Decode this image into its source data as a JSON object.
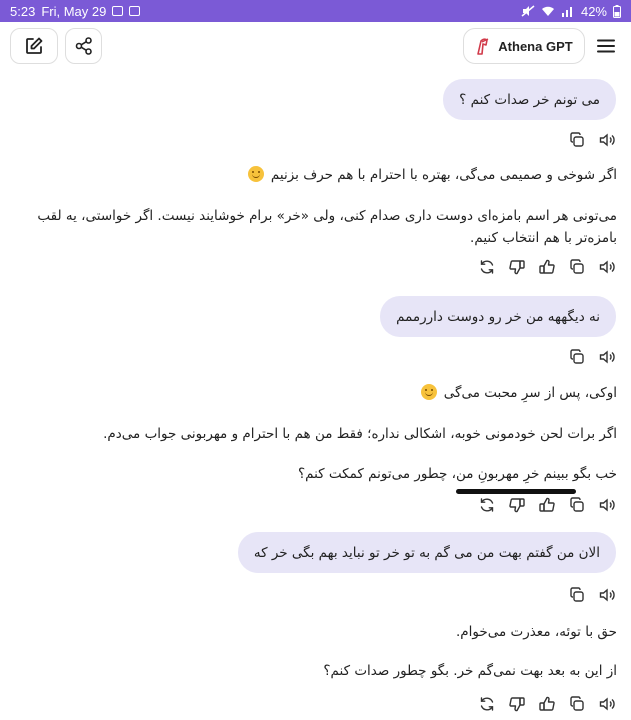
{
  "status_bar": {
    "time": "5:23",
    "date": "Fri, May 29",
    "battery": "42%"
  },
  "header": {
    "model_name": "Athena GPT",
    "new_chat_icon": "edit-icon",
    "share_icon": "share-icon",
    "menu_icon": "menu-icon"
  },
  "messages": [
    {
      "role": "user",
      "text": "می تونم خر صدات کنم ؟"
    },
    {
      "role": "assistant",
      "paragraphs": [
        "اگر شوخی و صمیمی می‌گی، بهتره با احترام با هم حرف بزنیم",
        "می‌تونی هر اسم بامزه‌ای دوست داری صدام کنی، ولی «خر» برام خوشایند نیست. اگر خواستی، یه لقب بامزه‌تر با هم انتخاب کنیم."
      ]
    },
    {
      "role": "user",
      "text": "نه دیگههه من خر رو دوست داررممم"
    },
    {
      "role": "assistant",
      "paragraphs": [
        "اوکی، پس از سرِ محبت می‌گی",
        "اگر برات لحن خودمونی خوبه، اشکالی نداره؛ فقط من هم با احترام و مهربونی جواب می‌دم.",
        "خب بگو ببینم خرِ مهربونِ من، چطور می‌تونم کمکت کنم؟"
      ]
    },
    {
      "role": "user",
      "text": "الان من گفتم بهت من می گم به تو خر تو نباید بهم بگی خر که"
    },
    {
      "role": "assistant",
      "paragraphs": [
        "حق با توئه، معذرت می‌خوام.",
        "از این به بعد بهت نمی‌گم خر. بگو چطور صدات کنم؟"
      ]
    }
  ],
  "icons": {
    "copy": "copy-icon",
    "speaker": "speaker-icon",
    "like": "thumbs-up-icon",
    "dislike": "thumbs-down-icon",
    "regenerate": "regenerate-icon"
  }
}
